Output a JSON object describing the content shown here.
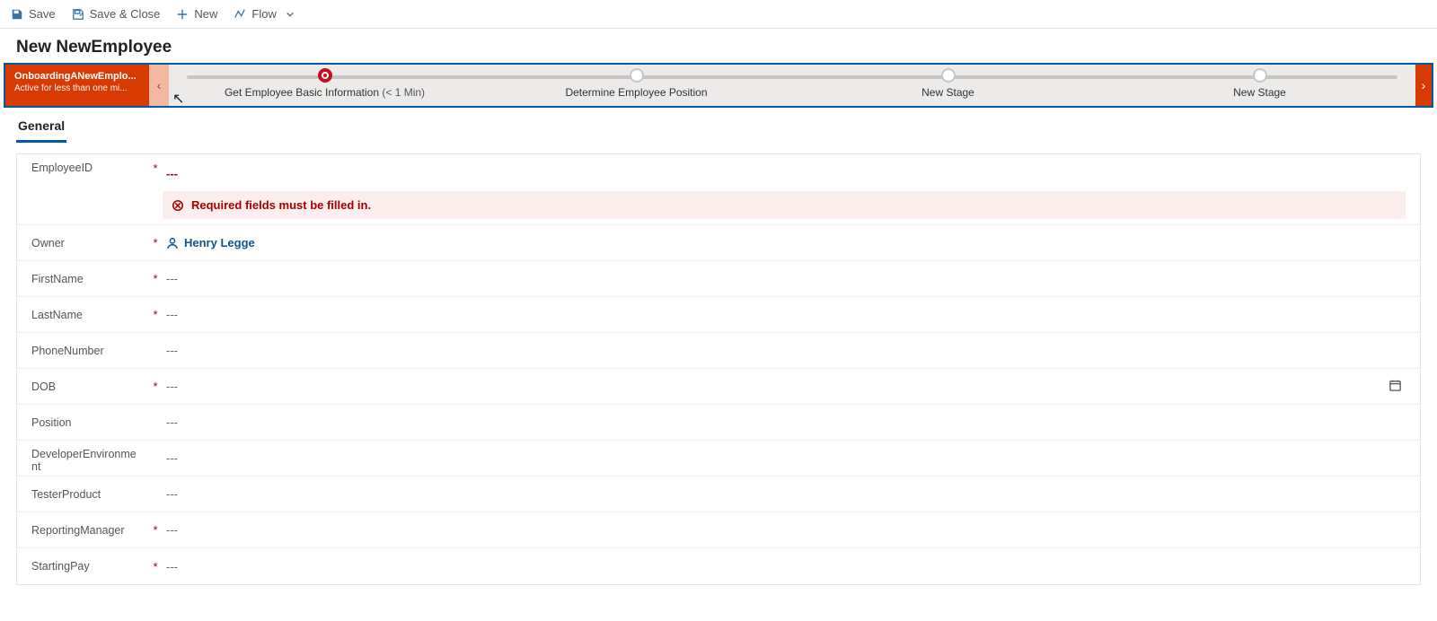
{
  "toolbar": {
    "save": "Save",
    "save_close": "Save & Close",
    "new": "New",
    "flow": "Flow"
  },
  "page_title": "New NewEmployee",
  "bpf": {
    "process_name": "OnboardingANewEmplo...",
    "active_text": "Active for less than one mi...",
    "stages": [
      {
        "label": "Get Employee Basic Information",
        "sublabel": "(< 1 Min)",
        "active": true
      },
      {
        "label": "Determine Employee Position",
        "sublabel": "",
        "active": false
      },
      {
        "label": "New Stage",
        "sublabel": "",
        "active": false
      },
      {
        "label": "New Stage",
        "sublabel": "",
        "active": false
      }
    ]
  },
  "tab_general": "General",
  "error_text": "Required fields must be filled in.",
  "owner_value": "Henry Legge",
  "empty": "---",
  "fields": {
    "employee_id": "EmployeeID",
    "owner": "Owner",
    "first_name": "FirstName",
    "last_name": "LastName",
    "phone": "PhoneNumber",
    "dob": "DOB",
    "position": "Position",
    "dev_env": "DeveloperEnvironment",
    "tester_product": "TesterProduct",
    "reporting_mgr": "ReportingManager",
    "starting_pay": "StartingPay"
  }
}
